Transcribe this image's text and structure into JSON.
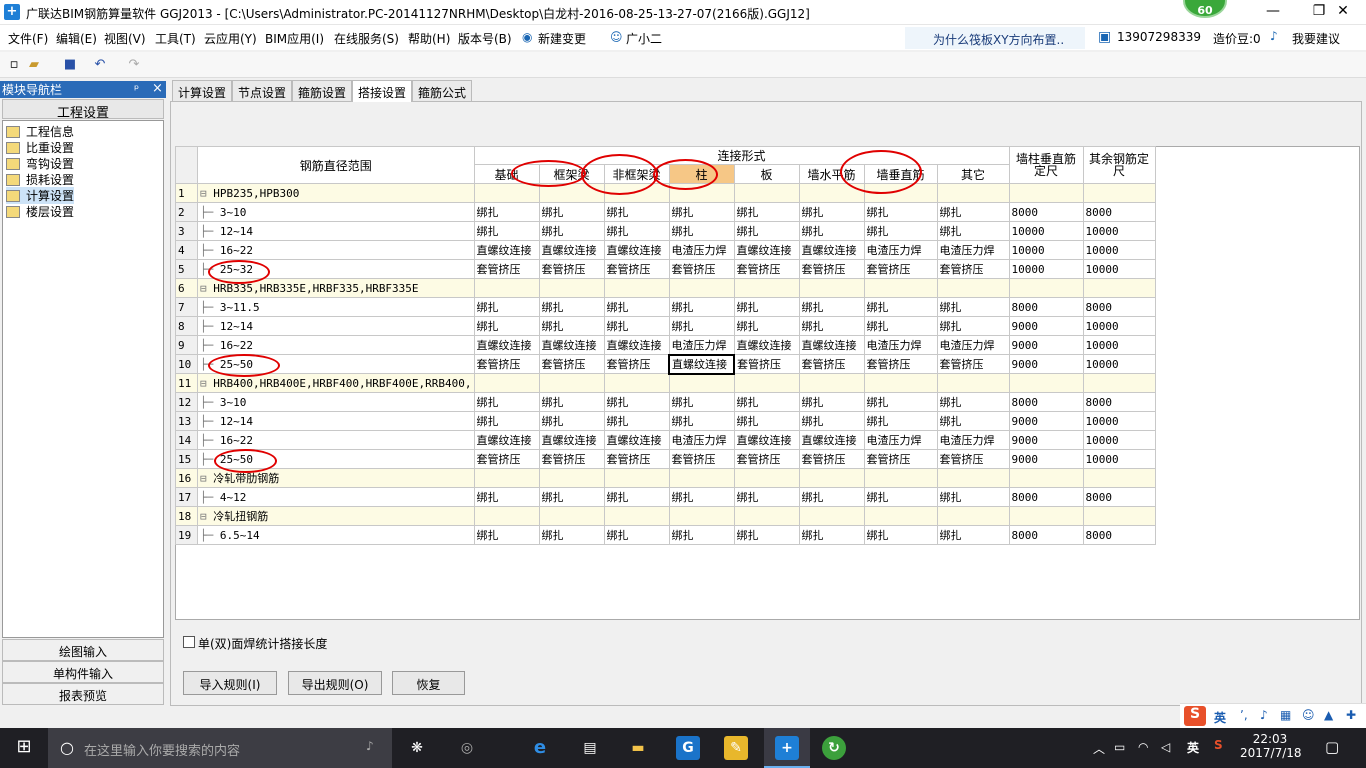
{
  "window": {
    "title": "广联达BIM钢筋算量软件 GGJ2013 - [C:\\Users\\Administrator.PC-20141127NRHM\\Desktop\\白龙村-2016-08-25-13-27-07(2166版).GGJ12]",
    "badge": "60",
    "min": "—",
    "max": "❐",
    "close": "✕"
  },
  "menu": {
    "items": [
      "文件(F)",
      "编辑(E)",
      "视图(V)",
      "工具(T)",
      "云应用(Y)",
      "BIM应用(I)",
      "在线服务(S)",
      "帮助(H)",
      "版本号(B)",
      "新建变更",
      "广小二"
    ],
    "hint": "为什么筏板XY方向布置..",
    "phone": "13907298339",
    "coins": "造价豆:0",
    "suggest": "我要建议"
  },
  "nav": {
    "header": "模块导航栏",
    "pin": "ᵖ",
    "close": "×",
    "section": "工程设置",
    "items": [
      "工程信息",
      "比重设置",
      "弯钩设置",
      "损耗设置",
      "计算设置",
      "楼层设置"
    ],
    "bottom": [
      "绘图输入",
      "单构件输入",
      "报表预览"
    ]
  },
  "tabs": [
    "计算设置",
    "节点设置",
    "箍筋设置",
    "搭接设置",
    "箍筋公式"
  ],
  "grid": {
    "header_range": "钢筋直径范围",
    "header_conn": "连接形式",
    "header_wall": "墙柱垂直筋定尺",
    "header_other": "其余钢筋定尺",
    "cols": [
      "基础",
      "框架梁",
      "非框架梁",
      "柱",
      "板",
      "墙水平筋",
      "墙垂直筋",
      "其它"
    ],
    "rows": [
      {
        "n": "1",
        "label": "HPB235,HPB300",
        "group": true,
        "cells": [
          "",
          "",
          "",
          "",
          "",
          "",
          "",
          ""
        ],
        "w": "",
        "o": ""
      },
      {
        "n": "2",
        "label": "3~10",
        "group": false,
        "cells": [
          "绑扎",
          "绑扎",
          "绑扎",
          "绑扎",
          "绑扎",
          "绑扎",
          "绑扎",
          "绑扎"
        ],
        "w": "8000",
        "o": "8000"
      },
      {
        "n": "3",
        "label": "12~14",
        "group": false,
        "cells": [
          "绑扎",
          "绑扎",
          "绑扎",
          "绑扎",
          "绑扎",
          "绑扎",
          "绑扎",
          "绑扎"
        ],
        "w": "10000",
        "o": "10000"
      },
      {
        "n": "4",
        "label": "16~22",
        "group": false,
        "cells": [
          "直螺纹连接",
          "直螺纹连接",
          "直螺纹连接",
          "电渣压力焊",
          "直螺纹连接",
          "直螺纹连接",
          "电渣压力焊",
          "电渣压力焊"
        ],
        "w": "10000",
        "o": "10000"
      },
      {
        "n": "5",
        "label": "25~32",
        "group": false,
        "cells": [
          "套管挤压",
          "套管挤压",
          "套管挤压",
          "套管挤压",
          "套管挤压",
          "套管挤压",
          "套管挤压",
          "套管挤压"
        ],
        "w": "10000",
        "o": "10000"
      },
      {
        "n": "6",
        "label": "HRB335,HRB335E,HRBF335,HRBF335E",
        "group": true,
        "cells": [
          "",
          "",
          "",
          "",
          "",
          "",
          "",
          ""
        ],
        "w": "",
        "o": ""
      },
      {
        "n": "7",
        "label": "3~11.5",
        "group": false,
        "cells": [
          "绑扎",
          "绑扎",
          "绑扎",
          "绑扎",
          "绑扎",
          "绑扎",
          "绑扎",
          "绑扎"
        ],
        "w": "8000",
        "o": "8000"
      },
      {
        "n": "8",
        "label": "12~14",
        "group": false,
        "cells": [
          "绑扎",
          "绑扎",
          "绑扎",
          "绑扎",
          "绑扎",
          "绑扎",
          "绑扎",
          "绑扎"
        ],
        "w": "9000",
        "o": "10000"
      },
      {
        "n": "9",
        "label": "16~22",
        "group": false,
        "cells": [
          "直螺纹连接",
          "直螺纹连接",
          "直螺纹连接",
          "电渣压力焊",
          "直螺纹连接",
          "直螺纹连接",
          "电渣压力焊",
          "电渣压力焊"
        ],
        "w": "9000",
        "o": "10000"
      },
      {
        "n": "10",
        "label": "25~50",
        "group": false,
        "cells": [
          "套管挤压",
          "套管挤压",
          "套管挤压",
          "直螺纹连接",
          "套管挤压",
          "套管挤压",
          "套管挤压",
          "套管挤压"
        ],
        "w": "9000",
        "o": "10000"
      },
      {
        "n": "11",
        "label": "HRB400,HRB400E,HRBF400,HRBF400E,RRB400,",
        "group": true,
        "cells": [
          "",
          "",
          "",
          "",
          "",
          "",
          "",
          ""
        ],
        "w": "",
        "o": ""
      },
      {
        "n": "12",
        "label": "3~10",
        "group": false,
        "cells": [
          "绑扎",
          "绑扎",
          "绑扎",
          "绑扎",
          "绑扎",
          "绑扎",
          "绑扎",
          "绑扎"
        ],
        "w": "8000",
        "o": "8000"
      },
      {
        "n": "13",
        "label": "12~14",
        "group": false,
        "cells": [
          "绑扎",
          "绑扎",
          "绑扎",
          "绑扎",
          "绑扎",
          "绑扎",
          "绑扎",
          "绑扎"
        ],
        "w": "9000",
        "o": "10000"
      },
      {
        "n": "14",
        "label": "16~22",
        "group": false,
        "cells": [
          "直螺纹连接",
          "直螺纹连接",
          "直螺纹连接",
          "电渣压力焊",
          "直螺纹连接",
          "直螺纹连接",
          "电渣压力焊",
          "电渣压力焊"
        ],
        "w": "9000",
        "o": "10000"
      },
      {
        "n": "15",
        "label": "25~50",
        "group": false,
        "cells": [
          "套管挤压",
          "套管挤压",
          "套管挤压",
          "套管挤压",
          "套管挤压",
          "套管挤压",
          "套管挤压",
          "套管挤压"
        ],
        "w": "9000",
        "o": "10000"
      },
      {
        "n": "16",
        "label": "冷轧带肋钢筋",
        "group": true,
        "cells": [
          "",
          "",
          "",
          "",
          "",
          "",
          "",
          ""
        ],
        "w": "",
        "o": ""
      },
      {
        "n": "17",
        "label": "4~12",
        "group": false,
        "cells": [
          "绑扎",
          "绑扎",
          "绑扎",
          "绑扎",
          "绑扎",
          "绑扎",
          "绑扎",
          "绑扎"
        ],
        "w": "8000",
        "o": "8000"
      },
      {
        "n": "18",
        "label": "冷轧扭钢筋",
        "group": true,
        "cells": [
          "",
          "",
          "",
          "",
          "",
          "",
          "",
          ""
        ],
        "w": "",
        "o": ""
      },
      {
        "n": "19",
        "label": "6.5~14",
        "group": false,
        "cells": [
          "绑扎",
          "绑扎",
          "绑扎",
          "绑扎",
          "绑扎",
          "绑扎",
          "绑扎",
          "绑扎"
        ],
        "w": "8000",
        "o": "8000"
      }
    ]
  },
  "checkbox": "单(双)面焊统计搭接长度",
  "buttons": {
    "import": "导入规则(I)",
    "export": "导出规则(O)",
    "restore": "恢复"
  },
  "ime": {
    "lang": "英"
  },
  "taskbar": {
    "search": "在这里输入你要搜索的内容",
    "time": "22:03",
    "date": "2017/7/18",
    "lang": "英"
  }
}
